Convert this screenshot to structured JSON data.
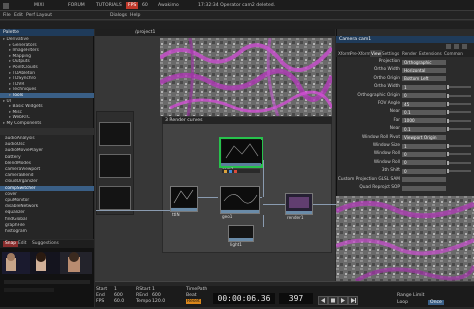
{
  "topbar": {
    "items": [
      "MIXI",
      "FORUM",
      "TUTORIALS",
      "FPS",
      "60",
      "Awakimo",
      "17:32:34 Operator cam2 deleted."
    ],
    "accent_color": "#c0392b"
  },
  "menubar": {
    "items": [
      "File",
      "Edit",
      "Perf Layout",
      "Dialogs",
      "Help"
    ],
    "pane_label": "Palette"
  },
  "palette": {
    "title": "Palette",
    "items": [
      {
        "label": "Derivative",
        "indent": 0
      },
      {
        "label": "Generators",
        "indent": 1
      },
      {
        "label": "ImageFilters",
        "indent": 1
      },
      {
        "label": "Mapping",
        "indent": 1
      },
      {
        "label": "Outputs",
        "indent": 1
      },
      {
        "label": "PointClouds",
        "indent": 1
      },
      {
        "label": "TDAbleton",
        "indent": 1
      },
      {
        "label": "TDSynchro",
        "indent": 1
      },
      {
        "label": "TDVR",
        "indent": 1
      },
      {
        "label": "Techniques",
        "indent": 1
      },
      {
        "label": "Tools",
        "indent": 1
      },
      {
        "label": "UI",
        "indent": 0
      },
      {
        "label": "Basic Widgets",
        "indent": 1
      },
      {
        "label": "Misc",
        "indent": 1
      },
      {
        "label": "WebRTC",
        "indent": 1
      },
      {
        "label": "My Components",
        "indent": 0
      }
    ],
    "selected_index": 10,
    "components": [
      "audioAnalysis",
      "audioOsc",
      "audioMoviePlayer",
      "battery",
      "blendModes",
      "cameraViewport",
      "cameraBlend",
      "cloudOrganizer",
      "compSwitcher",
      "cover",
      "cpuMonitor",
      "disableNetwork",
      "equalizer",
      "findGlobal",
      "graphFile",
      "histogram"
    ],
    "components_selected_index": 8,
    "search_tabs": [
      "Snap",
      "Edit",
      "Suggestions"
    ]
  },
  "network": {
    "path": "/project1",
    "render_panel_title": "3 Render curves",
    "nodes": [
      {
        "label": "cam1",
        "selected": true
      },
      {
        "label": "geo1",
        "selected": false
      },
      {
        "label": "ttlN",
        "selected": false
      },
      {
        "label": "render1",
        "selected": false
      },
      {
        "label": "rmm2",
        "selected": false
      },
      {
        "label": "light1",
        "selected": false
      },
      {
        "label": "out1",
        "selected": false
      }
    ]
  },
  "params": {
    "header": "Camera  cam1",
    "tabs": [
      "Xform",
      "Pre-Xform",
      "View",
      "Settings",
      "Render",
      "Extensions",
      "Common"
    ],
    "rows": [
      {
        "label": "Projection",
        "value": "Orthographic"
      },
      {
        "label": "Ortho Width",
        "value": "Horizontal"
      },
      {
        "label": "Ortho Origin",
        "value": "Bottom Left"
      },
      {
        "label": "Ortho Width",
        "value": "1"
      },
      {
        "label": "Orthographic Origin",
        "value": "0"
      },
      {
        "label": "FOV Angle",
        "value": "45"
      },
      {
        "label": "Near",
        "value": "0.1"
      },
      {
        "label": "Far",
        "value": "1000"
      },
      {
        "label": "Near",
        "value": "0.1"
      },
      {
        "label": "Window Roll Pivot",
        "value": "Viewport Origin"
      },
      {
        "label": "Window Size",
        "value": "1"
      },
      {
        "label": "Window Roll",
        "value": "0"
      },
      {
        "label": "Window Roll",
        "value": "0"
      },
      {
        "label": "3th Shift",
        "value": "0"
      },
      {
        "label": "Custom Projection GLSL SAM",
        "value": ""
      },
      {
        "label": "Quad Reprojct SOP",
        "value": ""
      }
    ]
  },
  "timeline": {
    "timecode": "00:00:06.36",
    "frame": "397",
    "start_label": "Start",
    "start_value": "1",
    "end_label": "End",
    "end_value": "600",
    "rstart_label": "RStart",
    "rstart_value": "1",
    "rend_label": "REnd",
    "rend_value": "600",
    "fps_label": "FPS",
    "fps_value": "60.0",
    "tempo_label": "Tempo",
    "tempo_value": "120.0",
    "range_label": "Range Limit",
    "range_options": [
      "Loop",
      "Once"
    ],
    "timepath_label": "TimePath",
    "beat_label": "Beat",
    "reset_label": "Reset"
  }
}
